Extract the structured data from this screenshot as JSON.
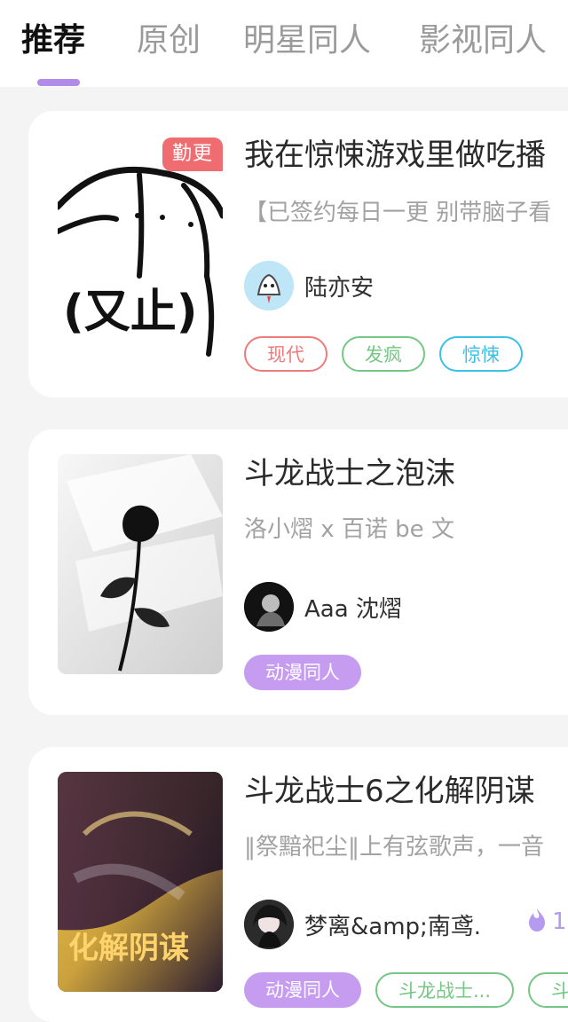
{
  "tabs": [
    {
      "label": "推荐",
      "active": true
    },
    {
      "label": "原创",
      "active": false
    },
    {
      "label": "明星同人",
      "active": false
    },
    {
      "label": "影视同人",
      "active": false
    }
  ],
  "books": [
    {
      "badge": "勤更",
      "title": "我在惊悚游戏里做吃播",
      "summary": "【已签约每日一更 别带脑子看",
      "cover_text": "(又止)",
      "author": {
        "name": "陆亦安"
      },
      "tags": [
        {
          "label": "现代",
          "style": "outline",
          "color": "#ef7a7b"
        },
        {
          "label": "发疯",
          "style": "outline",
          "color": "#74c784"
        },
        {
          "label": "惊悚",
          "style": "outline",
          "color": "#3bc0e6"
        }
      ]
    },
    {
      "title": "斗龙战士之泡沫",
      "summary": "洛小熠 x 百诺 be 文",
      "author": {
        "name": "Aaa 沈熠"
      },
      "tags": [
        {
          "label": "动漫同人",
          "style": "filled",
          "color": "#c59cf0"
        }
      ]
    },
    {
      "title": "斗龙战士6之化解阴谋",
      "summary": "‖祭黯祀尘‖上有弦歌声，一音",
      "cover_text": "化解阴谋",
      "author": {
        "name": "梦离&amp;南鸢."
      },
      "hot": "1",
      "tags": [
        {
          "label": "动漫同人",
          "style": "filled",
          "color": "#c59cf0"
        },
        {
          "label": "斗龙战士...",
          "style": "outline",
          "color": "#74c784"
        },
        {
          "label": "斗龙",
          "style": "outline",
          "color": "#74c784"
        }
      ]
    }
  ],
  "icons": {
    "hot_icon": "flame-icon"
  },
  "colors": {
    "accent": "#b28be8",
    "badge": "#ef6d71"
  }
}
